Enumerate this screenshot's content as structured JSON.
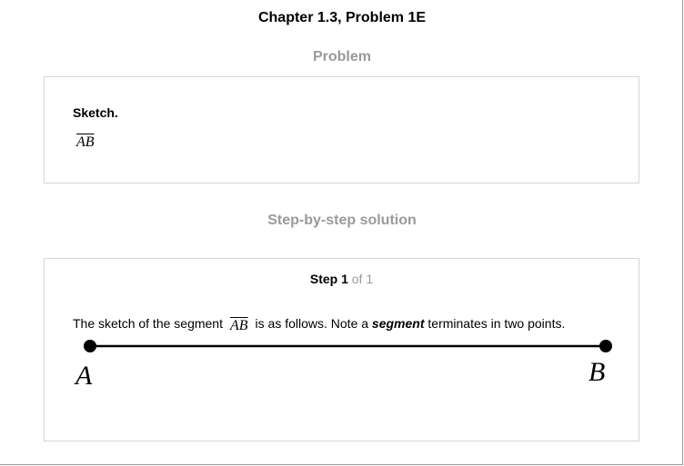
{
  "chapter_title": "Chapter 1.3, Problem 1E",
  "problem_heading": "Problem",
  "problem": {
    "label": "Sketch.",
    "math": "AB"
  },
  "solution_heading": "Step-by-step solution",
  "step": {
    "label": "Step 1",
    "of_text": "of 1",
    "text_before": "The sketch of the segment",
    "math": "AB",
    "text_middle": "is as follows. Note a",
    "term": "segment",
    "text_after": "terminates in two points."
  },
  "figure": {
    "point_a": "A",
    "point_b": "B"
  }
}
